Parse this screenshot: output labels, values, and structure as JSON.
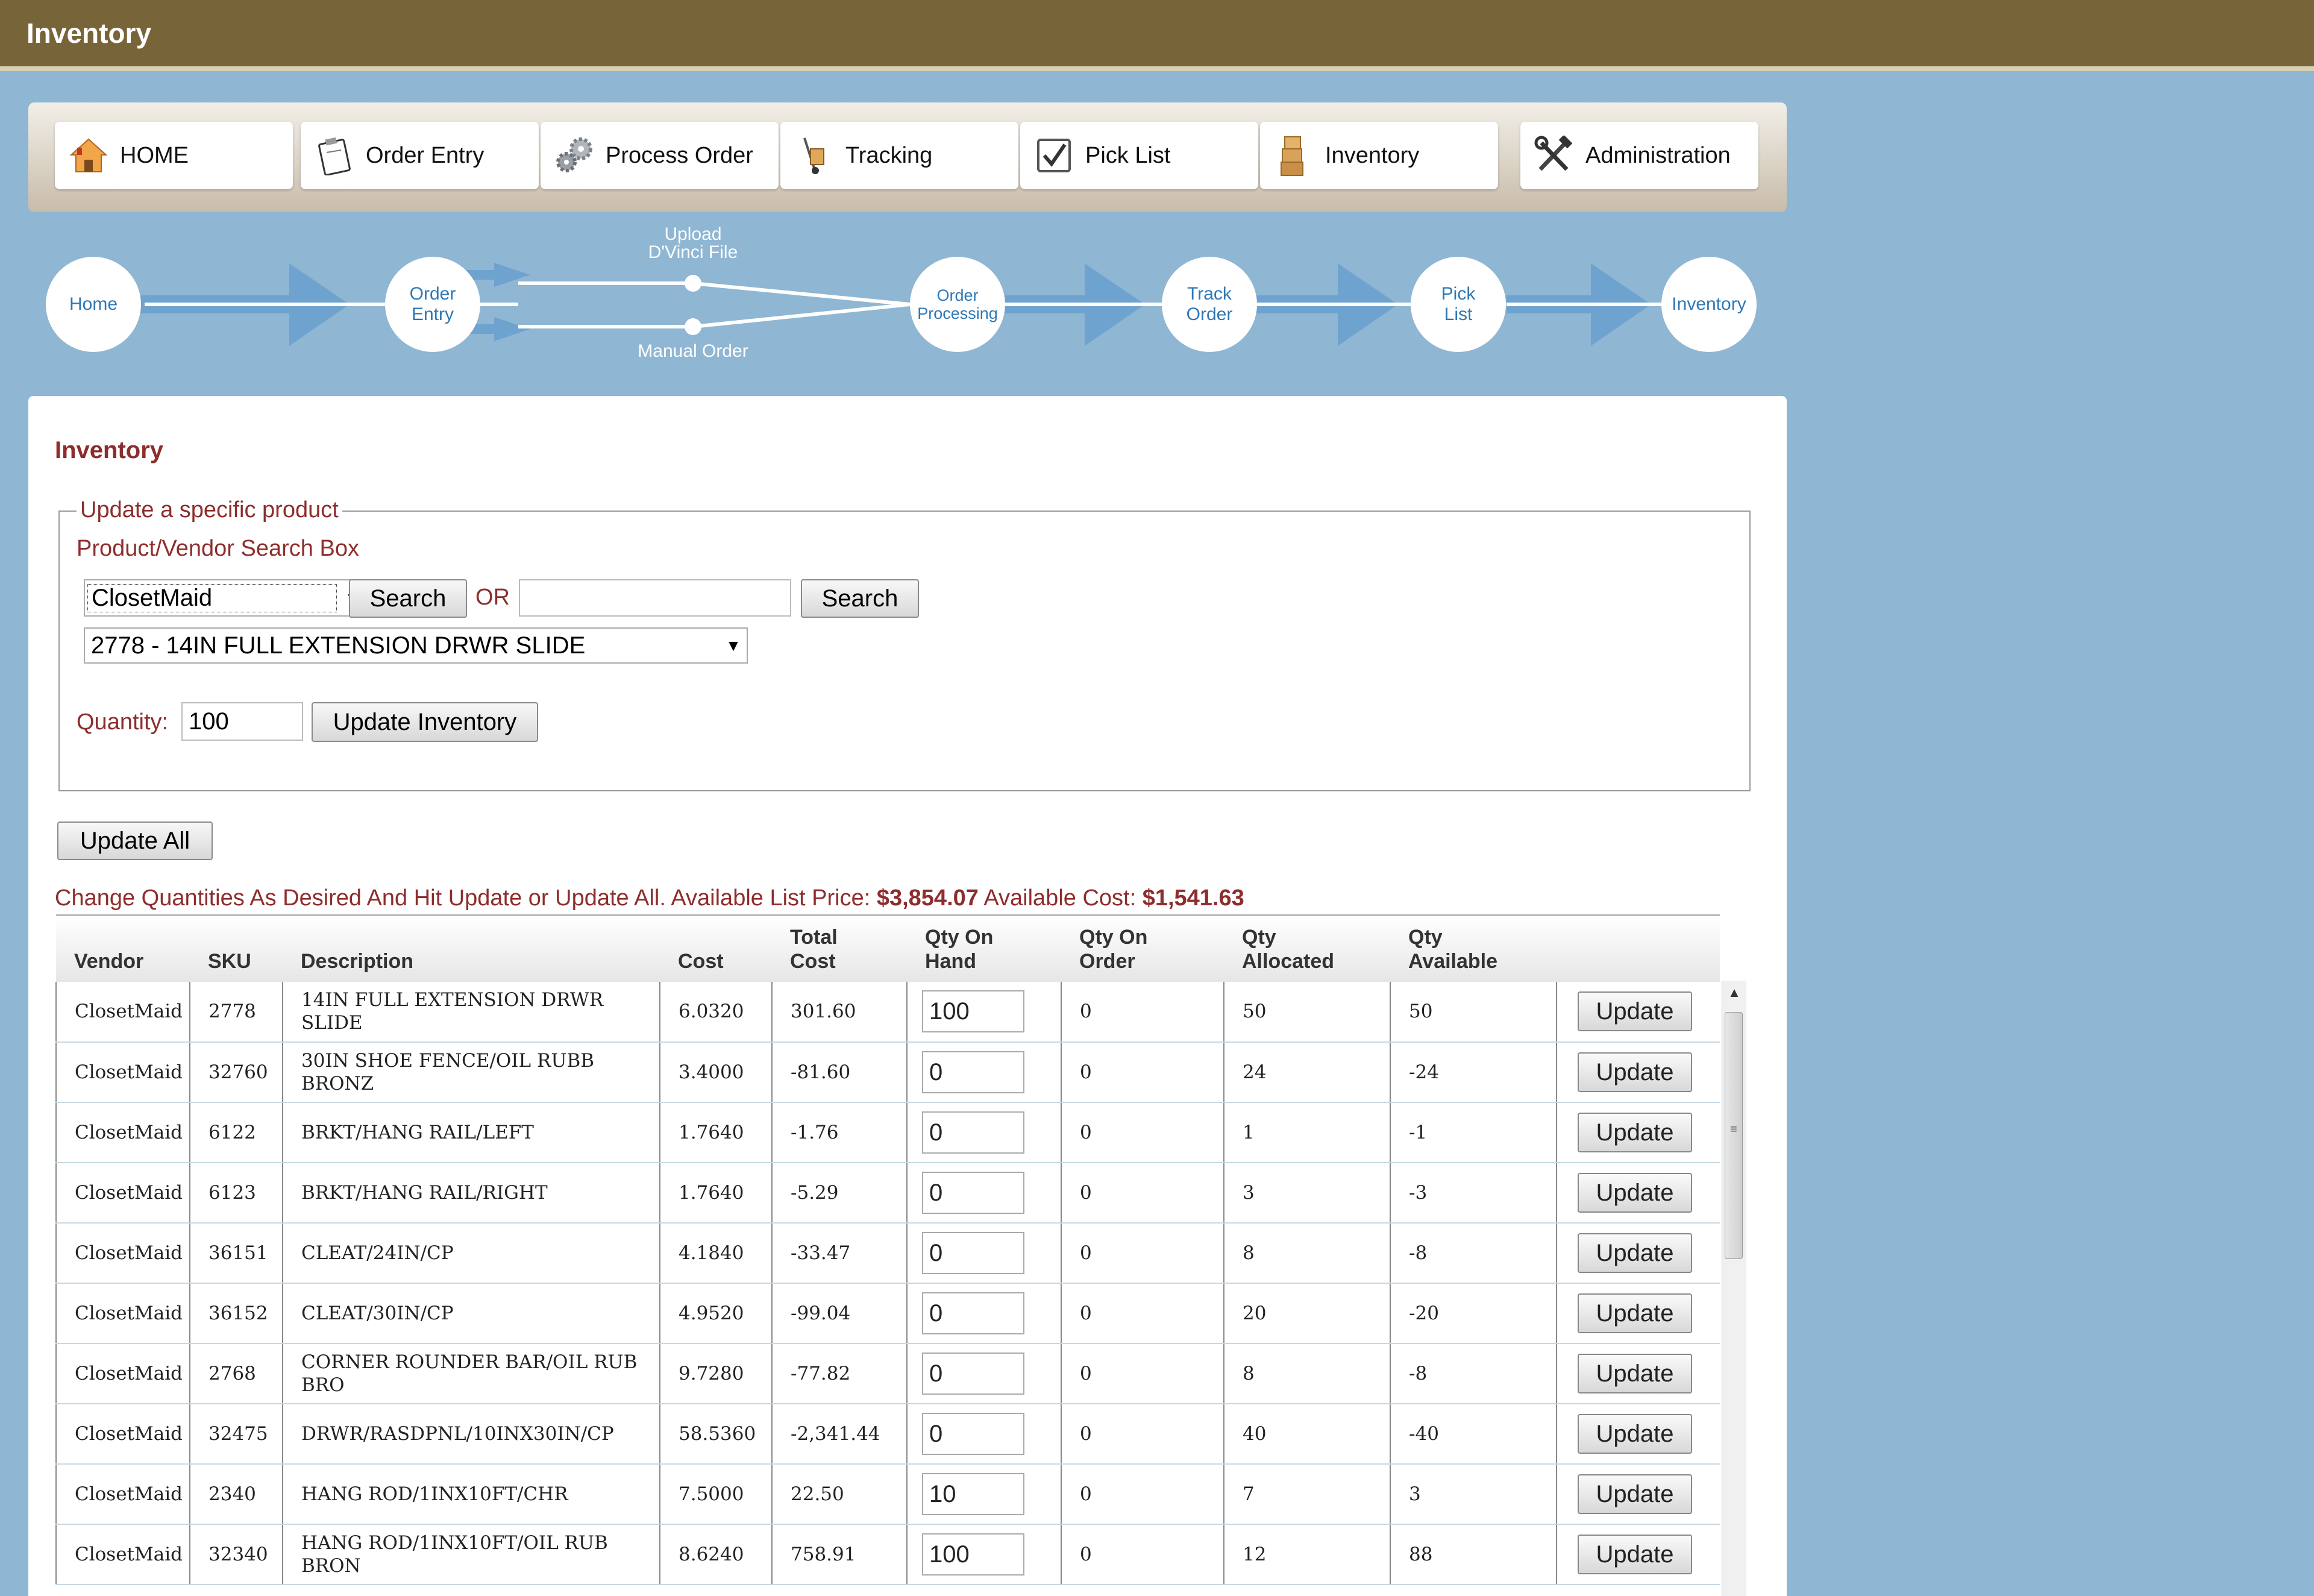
{
  "window": {
    "title": "Inventory"
  },
  "nav": [
    {
      "label": "HOME",
      "icon": "home-icon"
    },
    {
      "label": "Order Entry",
      "icon": "clipboard-icon"
    },
    {
      "label": "Process Order",
      "icon": "gears-icon"
    },
    {
      "label": "Tracking",
      "icon": "hand-truck-icon"
    },
    {
      "label": "Pick List",
      "icon": "checkbox-icon"
    },
    {
      "label": "Inventory",
      "icon": "boxes-icon"
    },
    {
      "label": "Administration",
      "icon": "tools-icon"
    }
  ],
  "workflow": {
    "home": "Home",
    "order_entry_1": "Order",
    "order_entry_2": "Entry",
    "upload_1": "Upload",
    "upload_2": "D'Vinci File",
    "manual": "Manual Order",
    "processing_1": "Order",
    "processing_2": "Processing",
    "track_1": "Track",
    "track_2": "Order",
    "pick_1": "Pick",
    "pick_2": "List",
    "inventory": "Inventory"
  },
  "page": {
    "title": "Inventory",
    "fieldset_legend": "Update a specific product",
    "search_box_label": "Product/Vendor Search Box",
    "vendor_select": "ClosetMaid",
    "search_button": "Search",
    "or_label": "OR",
    "search_text_value": "",
    "search_button_2": "Search",
    "product_select": "2778 - 14IN FULL EXTENSION DRWR SLIDE",
    "quantity_label": "Quantity:",
    "quantity_value": "100",
    "update_inventory_button": "Update Inventory",
    "update_all_button": "Update All",
    "summary_prefix": "Change Quantities As Desired And Hit Update or Update All. Available List Price: ",
    "list_price": "$3,854.07",
    "cost_label": " Available Cost: ",
    "available_cost": "$1,541.63"
  },
  "table": {
    "headers": {
      "vendor": "Vendor",
      "sku": "SKU",
      "description": "Description",
      "cost": "Cost",
      "total_cost_1": "Total",
      "total_cost_2": "Cost",
      "qty_on_hand_1": "Qty On",
      "qty_on_hand_2": "Hand",
      "qty_on_order_1": "Qty On",
      "qty_on_order_2": "Order",
      "qty_allocated_1": "Qty",
      "qty_allocated_2": "Allocated",
      "qty_available_1": "Qty",
      "qty_available_2": "Available"
    },
    "update_label": "Update",
    "rows": [
      {
        "vendor": "ClosetMaid",
        "sku": "2778",
        "description": "14IN FULL EXTENSION DRWR SLIDE",
        "cost": "6.0320",
        "total": "301.60",
        "on_hand": "100",
        "on_order": "0",
        "allocated": "50",
        "available": "50"
      },
      {
        "vendor": "ClosetMaid",
        "sku": "32760",
        "description": "30IN SHOE FENCE/OIL RUBB BRONZ",
        "cost": "3.4000",
        "total": "-81.60",
        "on_hand": "0",
        "on_order": "0",
        "allocated": "24",
        "available": "-24"
      },
      {
        "vendor": "ClosetMaid",
        "sku": "6122",
        "description": "BRKT/HANG RAIL/LEFT",
        "cost": "1.7640",
        "total": "-1.76",
        "on_hand": "0",
        "on_order": "0",
        "allocated": "1",
        "available": "-1"
      },
      {
        "vendor": "ClosetMaid",
        "sku": "6123",
        "description": "BRKT/HANG RAIL/RIGHT",
        "cost": "1.7640",
        "total": "-5.29",
        "on_hand": "0",
        "on_order": "0",
        "allocated": "3",
        "available": "-3"
      },
      {
        "vendor": "ClosetMaid",
        "sku": "36151",
        "description": "CLEAT/24IN/CP",
        "cost": "4.1840",
        "total": "-33.47",
        "on_hand": "0",
        "on_order": "0",
        "allocated": "8",
        "available": "-8"
      },
      {
        "vendor": "ClosetMaid",
        "sku": "36152",
        "description": "CLEAT/30IN/CP",
        "cost": "4.9520",
        "total": "-99.04",
        "on_hand": "0",
        "on_order": "0",
        "allocated": "20",
        "available": "-20"
      },
      {
        "vendor": "ClosetMaid",
        "sku": "2768",
        "description": "CORNER ROUNDER BAR/OIL RUB BRO",
        "cost": "9.7280",
        "total": "-77.82",
        "on_hand": "0",
        "on_order": "0",
        "allocated": "8",
        "available": "-8"
      },
      {
        "vendor": "ClosetMaid",
        "sku": "32475",
        "description": "DRWR/RASDPNL/10INX30IN/CP",
        "cost": "58.5360",
        "total": "-2,341.44",
        "on_hand": "0",
        "on_order": "0",
        "allocated": "40",
        "available": "-40"
      },
      {
        "vendor": "ClosetMaid",
        "sku": "2340",
        "description": "HANG ROD/1INX10FT/CHR",
        "cost": "7.5000",
        "total": "22.50",
        "on_hand": "10",
        "on_order": "0",
        "allocated": "7",
        "available": "3"
      },
      {
        "vendor": "ClosetMaid",
        "sku": "32340",
        "description": "HANG ROD/1INX10FT/OIL RUB BRON",
        "cost": "8.6240",
        "total": "758.91",
        "on_hand": "100",
        "on_order": "0",
        "allocated": "12",
        "available": "88"
      }
    ]
  },
  "colors": {
    "header_bar": "#786439",
    "background": "#8fb6d3",
    "accent_red": "#8e2d2d",
    "workflow_text": "#2d78b6"
  }
}
